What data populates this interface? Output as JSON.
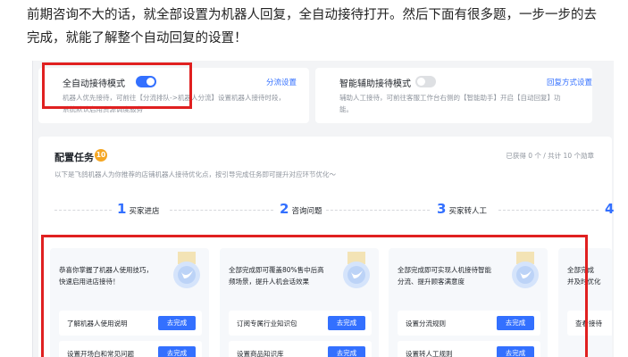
{
  "article": {
    "line1": "前期咨询不大的话，就全部设置为机器人回复，全自动接待打开。然后下面有很多题，一步一步的去",
    "line2": "完成，就能了解整个自动回复的设置！"
  },
  "auto_reception": {
    "title": "全自动接待模式",
    "link": "分流设置",
    "desc_line1": "机器人优先接待，可前往【分流排队->机器人分流】设置机器人接待时段，",
    "desc_line2": "系统默认启用资源调度服务",
    "toggle_on": true
  },
  "assist_reception": {
    "title": "智能辅助接待模式",
    "link": "回复方式设置",
    "desc_line1": "辅助人工接待，可前往客服工作台右侧的【智能助手】开启【自动回复】功",
    "desc_line2": "能。",
    "toggle_on": false
  },
  "task": {
    "title": "配置任务",
    "badge": "10",
    "count": "已获得 0 个 / 共计 10 个勋章",
    "subtitle": "以下是飞鸽机器人为你推荐的店铺机器人接待优化点，按引导完成任务即可提升对应环节优化～",
    "steps": [
      {
        "num": "1",
        "label": "买家进店"
      },
      {
        "num": "2",
        "label": "咨询问题"
      },
      {
        "num": "3",
        "label": "买家转人工"
      },
      {
        "num": "4",
        "label": ""
      }
    ],
    "cards": [
      {
        "desc_line1": "恭喜你掌握了机器人使用技巧，",
        "desc_line2": "快速启用进店接待！",
        "items": [
          {
            "label": "了解机器人使用说明",
            "button": "去完成"
          },
          {
            "label": "设置开场白和常见问题",
            "button": "去完成"
          }
        ]
      },
      {
        "desc_line1": "全部完成即可覆盖80%售中后高",
        "desc_line2": "频场景，提升人机会话效果",
        "items": [
          {
            "label": "订阅专属行业知识包",
            "button": "去完成"
          },
          {
            "label": "设置商品知识库",
            "button": "去完成"
          }
        ]
      },
      {
        "desc_line1": "全部完成即可实现人机接待智能",
        "desc_line2": "分流、提升顾客满意度",
        "items": [
          {
            "label": "设置分流规则",
            "button": "去完成"
          },
          {
            "label": "设置转人工规则",
            "button": "去完成"
          }
        ]
      },
      {
        "desc_line1": "全部完成",
        "desc_line2": "并及时优化",
        "items": [
          {
            "label": "查看接待",
            "button": ""
          }
        ]
      }
    ]
  },
  "colors": {
    "accent": "#3370ff",
    "highlight_box": "#e02020",
    "badge": "#f5a623"
  }
}
